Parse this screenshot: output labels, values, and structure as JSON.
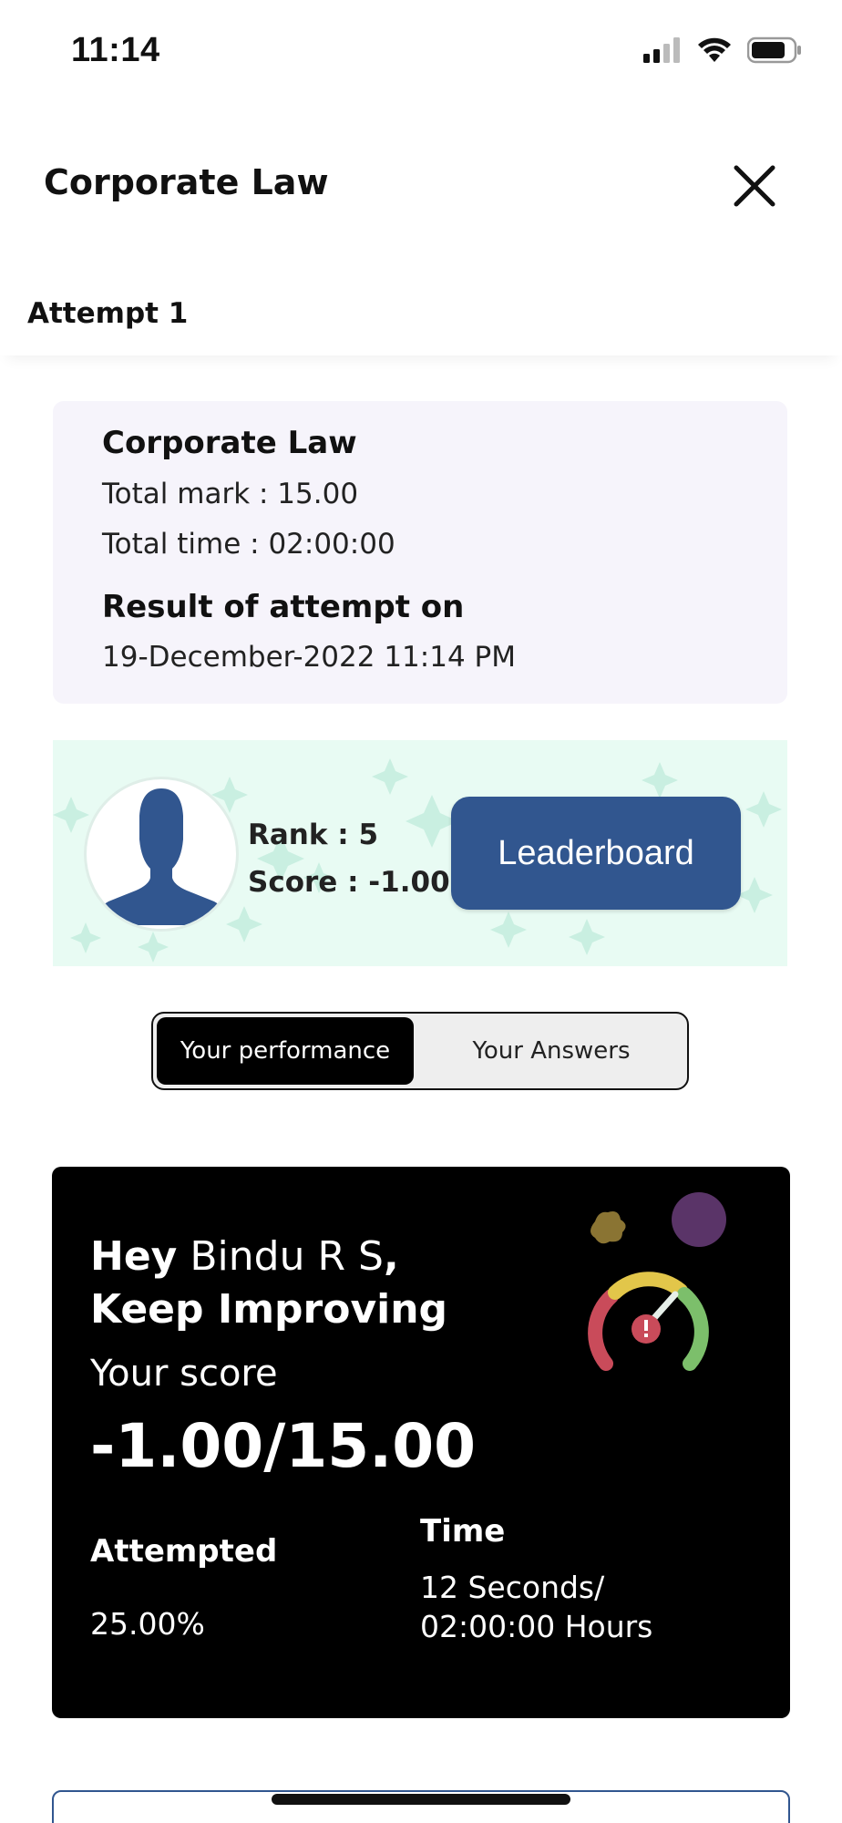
{
  "status_bar": {
    "time": "11:14"
  },
  "header": {
    "title": "Corporate Law",
    "close_icon": "close-icon"
  },
  "attempt": {
    "label": "Attempt 1"
  },
  "info_card": {
    "title": "Corporate Law",
    "total_mark": "Total mark : 15.00",
    "total_time": "Total time : 02:00:00",
    "result_heading": "Result of attempt on",
    "result_date": "19-December-2022 11:14 PM"
  },
  "rank_panel": {
    "rank_text": "Rank :  5",
    "score_text": "Score : -1.00",
    "leaderboard_label": "Leaderboard",
    "background_color": "#e8fbf3",
    "button_color": "#31568f"
  },
  "segment": {
    "tabs": [
      {
        "label": "Your performance",
        "active": true
      },
      {
        "label": "Your Answers",
        "active": false
      }
    ]
  },
  "performance": {
    "greeting_hey": "Hey",
    "user_name": "Bindu R S",
    "greeting_comma": ",",
    "motivation": "Keep Improving",
    "score_label": "Your score",
    "score_value": "-1.00/15.00",
    "attempted_label": "Attempted",
    "attempted_value": "25.00%",
    "time_label": "Time",
    "time_value_line1": "12 Seconds/",
    "time_value_line2": "02:00:00 Hours"
  }
}
